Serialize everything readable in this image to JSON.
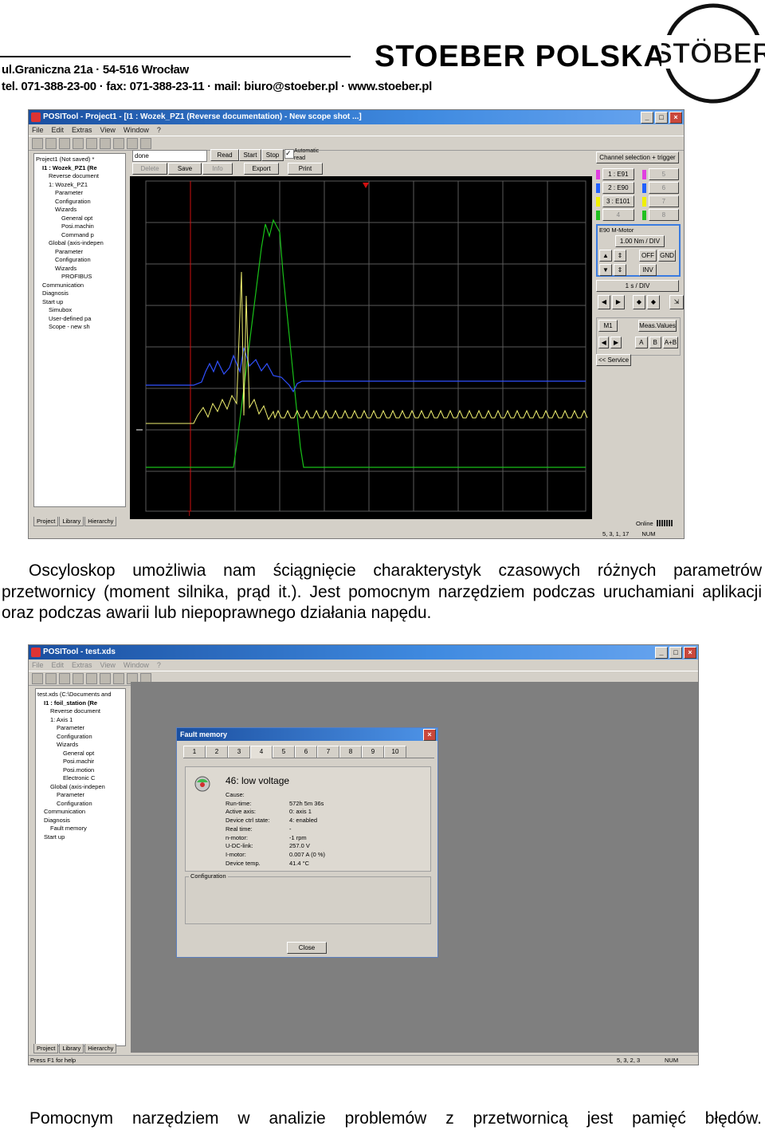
{
  "header": {
    "address_line1": "ul.Graniczna 21a · 54-516 Wrocław",
    "address_line2": "tel. 071-388-23-00 · fax: 071-388-23-11 · mail: biuro@stoeber.pl · www.stoeber.pl",
    "brand": "STOEBER POLSKA",
    "logo_text": "STÖBER"
  },
  "scope_window": {
    "title": "POSITool - Project1 - [I1 : Wozek_PZ1 (Reverse documentation) - New scope shot ...]",
    "menu": [
      "File",
      "Edit",
      "Extras",
      "View",
      "Window",
      "?"
    ],
    "tree": [
      "Project1 (Not saved) *",
      "I1 : Wozek_PZ1 (Re",
      "Reverse document",
      "1: Wozek_PZ1",
      "Parameter",
      "Configuration",
      "Wizards",
      "General opt",
      "Posi.machin",
      "Command p",
      "Global (axis-indepen",
      "Parameter",
      "Configuration",
      "Wizards",
      "PROFIBUS",
      "Communication",
      "Diagnosis",
      "Start up",
      "Simubox",
      "User-defined pa",
      "Scope - new sh"
    ],
    "tree_tabs": [
      "Project",
      "Library",
      "Hierarchy"
    ],
    "status_field": "done",
    "buttons_row1": [
      "Read",
      "Start",
      "Stop"
    ],
    "automatic_read": "Automatic read",
    "buttons_row2": [
      "Delete",
      "Save",
      "Info",
      "Export",
      "Print"
    ],
    "channel_title": "Channel selection + trigger",
    "channels": [
      {
        "label": "1 : E91",
        "color": "#e040e0",
        "num": "5"
      },
      {
        "label": "2 : E90",
        "color": "#2060ff",
        "num": "6"
      },
      {
        "label": "3 : E101",
        "color": "#f0f000",
        "num": "7"
      },
      {
        "label": "4",
        "color": "#20c020",
        "num": "8"
      }
    ],
    "channel_box_title": "E90 M-Motor",
    "channel_scale": "1.00 Nm / DIV",
    "ch_buttons": [
      "OFF",
      "GND",
      "INV"
    ],
    "timebase": "1 s / DIV",
    "marker": "M1",
    "meas_values": "Meas.Values",
    "marker_buttons": [
      "A",
      "B",
      "A+B"
    ],
    "service": "<< Service",
    "online": "Online",
    "status_cells": [
      "5, 3, 1, 17",
      "NUM"
    ],
    "trigger_marker": "T",
    "colors": {
      "green": "#18c018",
      "blue": "#3050ff",
      "yellow": "#f0f070",
      "red": "#d01010",
      "grid": "#5a5a5a"
    }
  },
  "paragraph": "Oscyloskop umożliwia nam ściągnięcie charakterystyk czasowych różnych parametrów przetwornicy (moment silnika, prąd it.). Jest pomocnym narzędziem podczas uruchamiani aplikacji oraz podczas awarii lub niepoprawnego działania napędu.",
  "fault_window": {
    "title": "POSITool - test.xds",
    "menu": [
      "File",
      "Edit",
      "Extras",
      "View",
      "Window",
      "?"
    ],
    "tree": [
      "test.xds (C:\\Documents and",
      "I1 : foil_station (Re",
      "Reverse document",
      "1: Axis 1",
      "Parameter",
      "Configuration",
      "Wizards",
      "General opt",
      "Posi.machir",
      "Posi.motion",
      "Electronic C",
      "Global (axis-indepen",
      "Parameter",
      "Configuration",
      "Communication",
      "Diagnosis",
      "Fault memory",
      "Start up"
    ],
    "tree_tabs": [
      "Project",
      "Library",
      "Hierarchy"
    ],
    "status_left": "Press F1 for help",
    "status_cells": [
      "5, 3, 2, 3",
      "NUM"
    ],
    "dialog": {
      "title": "Fault memory",
      "tabs": [
        "1",
        "2",
        "3",
        "4",
        "5",
        "6",
        "7",
        "8",
        "9",
        "10"
      ],
      "active_tab": "4",
      "fault_title": "46: low voltage",
      "rows": [
        {
          "k": "Cause:",
          "v": ""
        },
        {
          "k": "Run-time:",
          "v": "572h 5m 36s"
        },
        {
          "k": "Active axis:",
          "v": "0: axis 1"
        },
        {
          "k": "Device ctrl state:",
          "v": "4: enabled"
        },
        {
          "k": "Real time:",
          "v": "-"
        },
        {
          "k": "n-motor:",
          "v": "-1 rpm"
        },
        {
          "k": "U-DC-link:",
          "v": "257.0 V"
        },
        {
          "k": "I-motor:",
          "v": "0.007 A (0 %)"
        },
        {
          "k": "Device temp.",
          "v": "41.4 °C"
        }
      ],
      "configuration": "Configuration",
      "close": "Close"
    }
  },
  "bottom_text": "Pomocnym narzędziem w analizie problemów z przetwornicą jest pamięć błędów."
}
